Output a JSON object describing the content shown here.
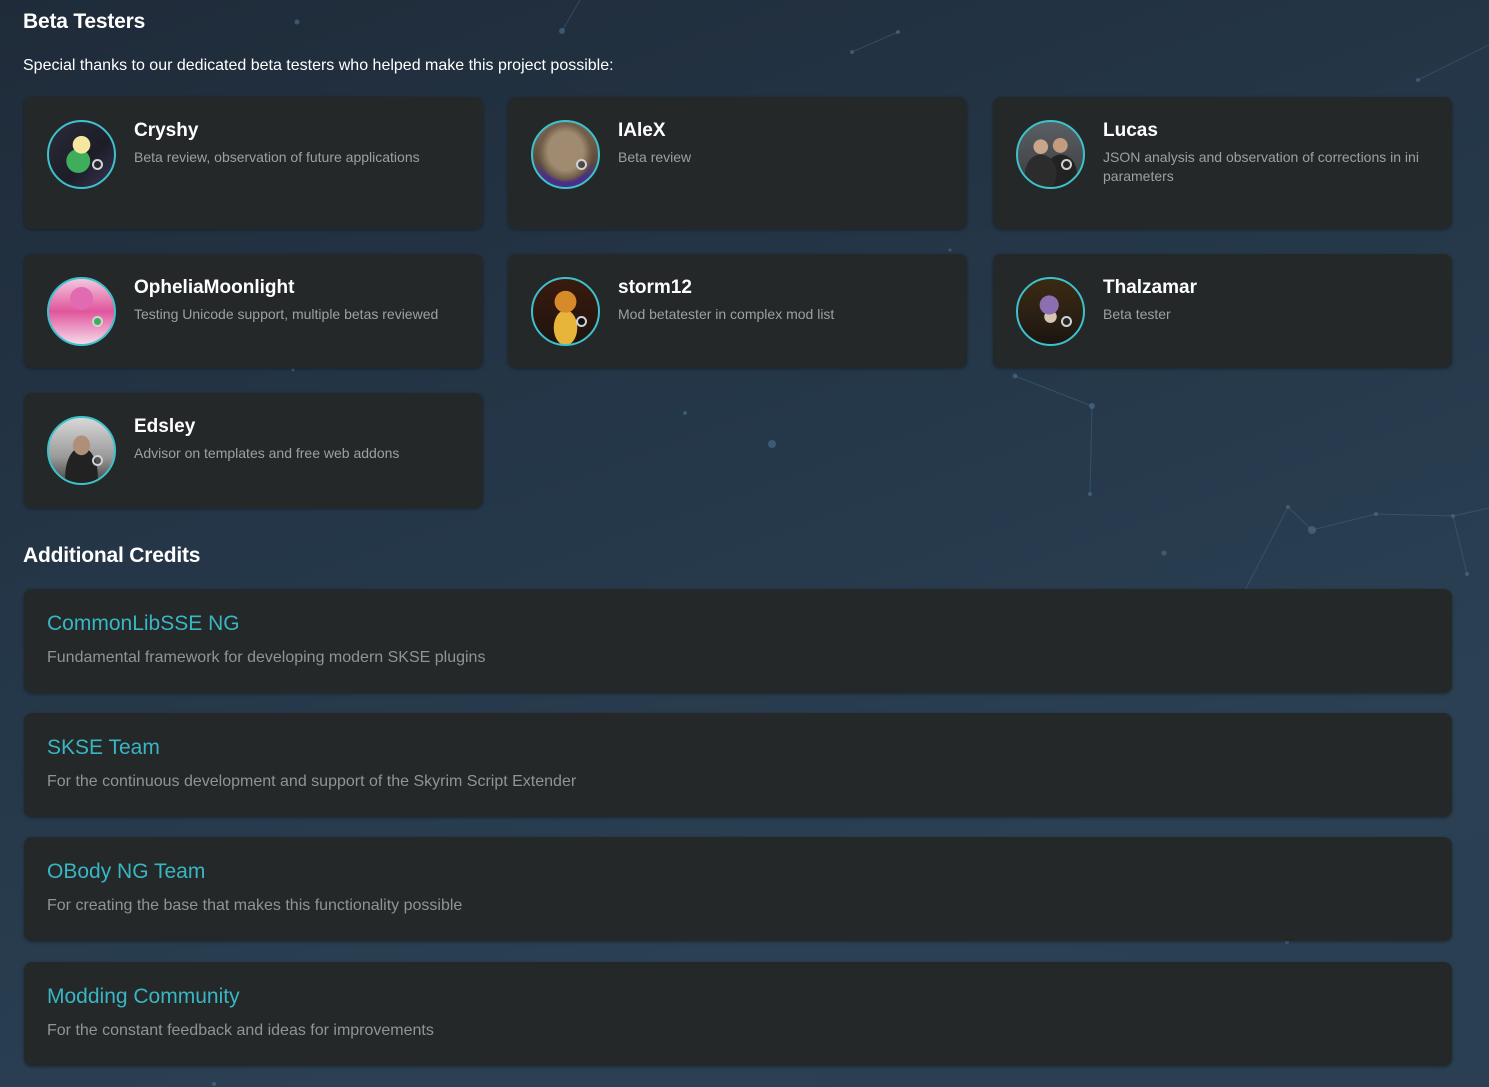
{
  "beta": {
    "title": "Beta Testers",
    "intro": "Special thanks to our dedicated beta testers who helped make this project possible:",
    "testers": [
      {
        "name": "Cryshy",
        "role": "Beta review, observation of future applications"
      },
      {
        "name": "IAleX",
        "role": "Beta review"
      },
      {
        "name": "Lucas",
        "role": "JSON analysis and observation of corrections in ini parameters"
      },
      {
        "name": "OpheliaMoonlight",
        "role": "Testing Unicode support, multiple betas reviewed"
      },
      {
        "name": "storm12",
        "role": "Mod betatester in complex mod list"
      },
      {
        "name": "Thalzamar",
        "role": "Beta tester"
      },
      {
        "name": "Edsley",
        "role": "Advisor on templates and free web addons"
      }
    ]
  },
  "credits": {
    "title": "Additional Credits",
    "items": [
      {
        "name": "CommonLibSSE NG",
        "desc": "Fundamental framework for developing modern SKSE plugins"
      },
      {
        "name": "SKSE Team",
        "desc": "For the continuous development and support of the Skyrim Script Extender"
      },
      {
        "name": "OBody NG Team",
        "desc": "For creating the base that makes this functionality possible"
      },
      {
        "name": "Modding Community",
        "desc": "For the constant feedback and ideas for improvements"
      }
    ]
  },
  "colors": {
    "accent": "#3cc2cc",
    "credit_title": "#38b6c4",
    "card_bg": "#252829",
    "muted_text": "#9aa0a4"
  }
}
